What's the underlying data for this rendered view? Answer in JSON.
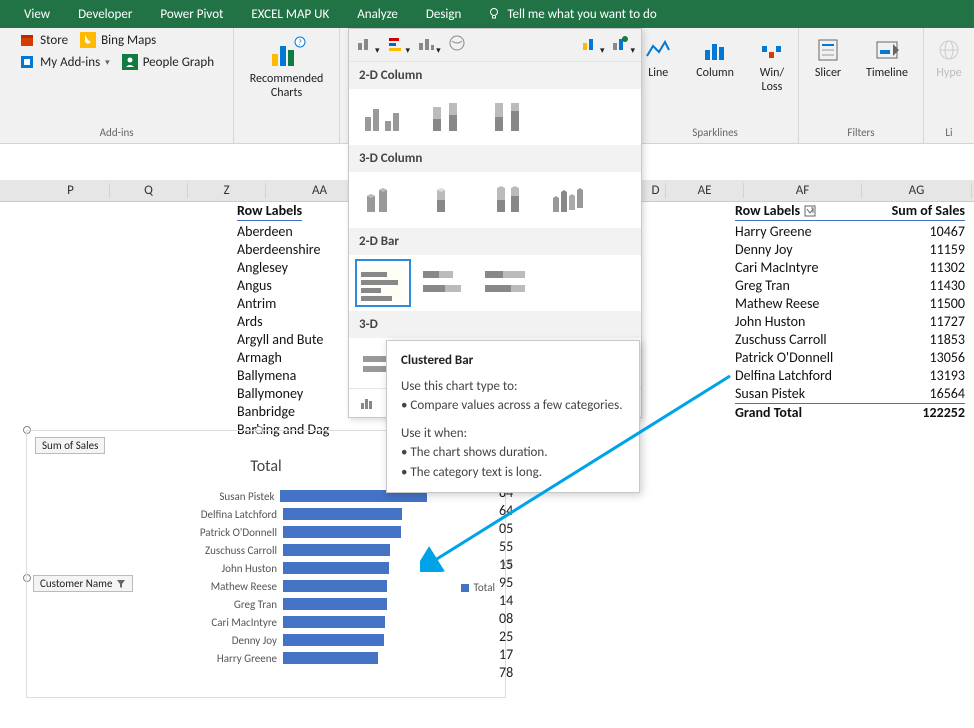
{
  "tabs": {
    "view": "View",
    "developer": "Developer",
    "powerpivot": "Power Pivot",
    "excelmap": "EXCEL MAP UK",
    "analyze": "Analyze",
    "design": "Design",
    "tell": "Tell me what you want to do"
  },
  "ribbon": {
    "store": "Store",
    "bingmaps": "Bing Maps",
    "myaddins": "My Add-ins",
    "peoplegraph": "People Graph",
    "addins": "Add-ins",
    "recommended": "Recommended\nCharts",
    "line": "Line",
    "column": "Column",
    "winloss": "Win/\nLoss",
    "sparklines": "Sparklines",
    "slicer": "Slicer",
    "timeline": "Timeline",
    "filters": "Filters",
    "hyper": "Hype",
    "links": "Li"
  },
  "dropdown": {
    "col2d": "2-D Column",
    "col3d": "3-D Column",
    "bar2d": "2-D Bar",
    "bar3d_prefix": "3-D"
  },
  "tooltip": {
    "title": "Clustered Bar",
    "use1": "Use this chart type to:",
    "b1": "• Compare values across a few categories.",
    "use2": "Use it when:",
    "b2": "• The chart shows duration.",
    "b3": "• The category text is long."
  },
  "columns": {
    "P": "P",
    "Q": "Q",
    "Z": "Z",
    "AA": "AA",
    "D": "D",
    "AE": "AE",
    "AF": "AF",
    "AG": "AG"
  },
  "pivot1_head": "Row Labels",
  "pivot1": [
    "Aberdeen",
    "Aberdeenshire",
    "Anglesey",
    "Angus",
    "Antrim",
    "Ards",
    "Argyll and Bute",
    "Armagh",
    "Ballymena",
    "Ballymoney",
    "Banbridge",
    "Barking and Dag"
  ],
  "pivot2_head": {
    "rl": "Row Labels",
    "sum": "Sum of Sales"
  },
  "pivot2": [
    {
      "name": "Harry Greene",
      "val": "10467"
    },
    {
      "name": "Denny Joy",
      "val": "11159"
    },
    {
      "name": "Cari MacIntyre",
      "val": "11302"
    },
    {
      "name": "Greg Tran",
      "val": "11430"
    },
    {
      "name": "Mathew Reese",
      "val": "11500"
    },
    {
      "name": "John Huston",
      "val": "11727"
    },
    {
      "name": "Zuschuss Carroll",
      "val": "11853"
    },
    {
      "name": "Patrick O'Donnell",
      "val": "13056"
    },
    {
      "name": "Delfina Latchford",
      "val": "13193"
    },
    {
      "name": "Susan Pistek",
      "val": "16564"
    }
  ],
  "grand": {
    "label": "Grand Total",
    "val": "122252"
  },
  "truncated": [
    "84",
    "64",
    "05",
    "55",
    "15",
    "95",
    "14",
    "08",
    "25",
    "17",
    "78"
  ],
  "chart": {
    "sum_badge": "Sum of Sales",
    "cust_badge": "Customer Name",
    "title": "Total",
    "legend": "Total"
  },
  "chart_data": {
    "type": "bar",
    "title": "Total",
    "xlabel": "Sum of Sales",
    "ylabel": "Customer Name",
    "categories": [
      "Susan Pistek",
      "Delfina Latchford",
      "Patrick O'Donnell",
      "Zuschuss Carroll",
      "John Huston",
      "Mathew Reese",
      "Greg Tran",
      "Cari MacIntyre",
      "Denny Joy",
      "Harry Greene"
    ],
    "values": [
      16564,
      13193,
      13056,
      11853,
      11727,
      11500,
      11430,
      11302,
      11159,
      10467
    ],
    "series": [
      {
        "name": "Total",
        "values": [
          16564,
          13193,
          13056,
          11853,
          11727,
          11500,
          11430,
          11302,
          11159,
          10467
        ]
      }
    ],
    "xlim": [
      0,
      18000
    ]
  }
}
